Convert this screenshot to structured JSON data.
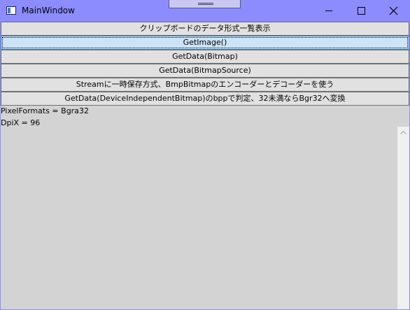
{
  "window": {
    "title": "MainWindow"
  },
  "buttons": [
    {
      "label": "クリップボードのデータ形式一覧表示"
    },
    {
      "label": "GetImage()"
    },
    {
      "label": "GetData(Bitmap)"
    },
    {
      "label": "GetData(BitmapSource)"
    },
    {
      "label": "Streamに一時保存方式、BmpBitmapのエンコーダーとデコーダーを使う"
    },
    {
      "label": "GetData(DeviceIndependentBitmap)のbppで判定、32未満ならBgr32へ変換"
    }
  ],
  "output": {
    "lines": [
      "PixelFormats = Bgra32",
      "DpiX = 96"
    ]
  },
  "colors": {
    "titlebar": "#8c8cff",
    "client_background": "#d3d3d3",
    "button_background": "#e1e1e1",
    "focused_button_background": "#cce4f7"
  },
  "icons": {
    "app": "window-app-icon",
    "minimize": "minimize-icon",
    "maximize": "maximize-icon",
    "close": "close-icon",
    "scroll_up": "scroll-up-arrow-icon"
  }
}
